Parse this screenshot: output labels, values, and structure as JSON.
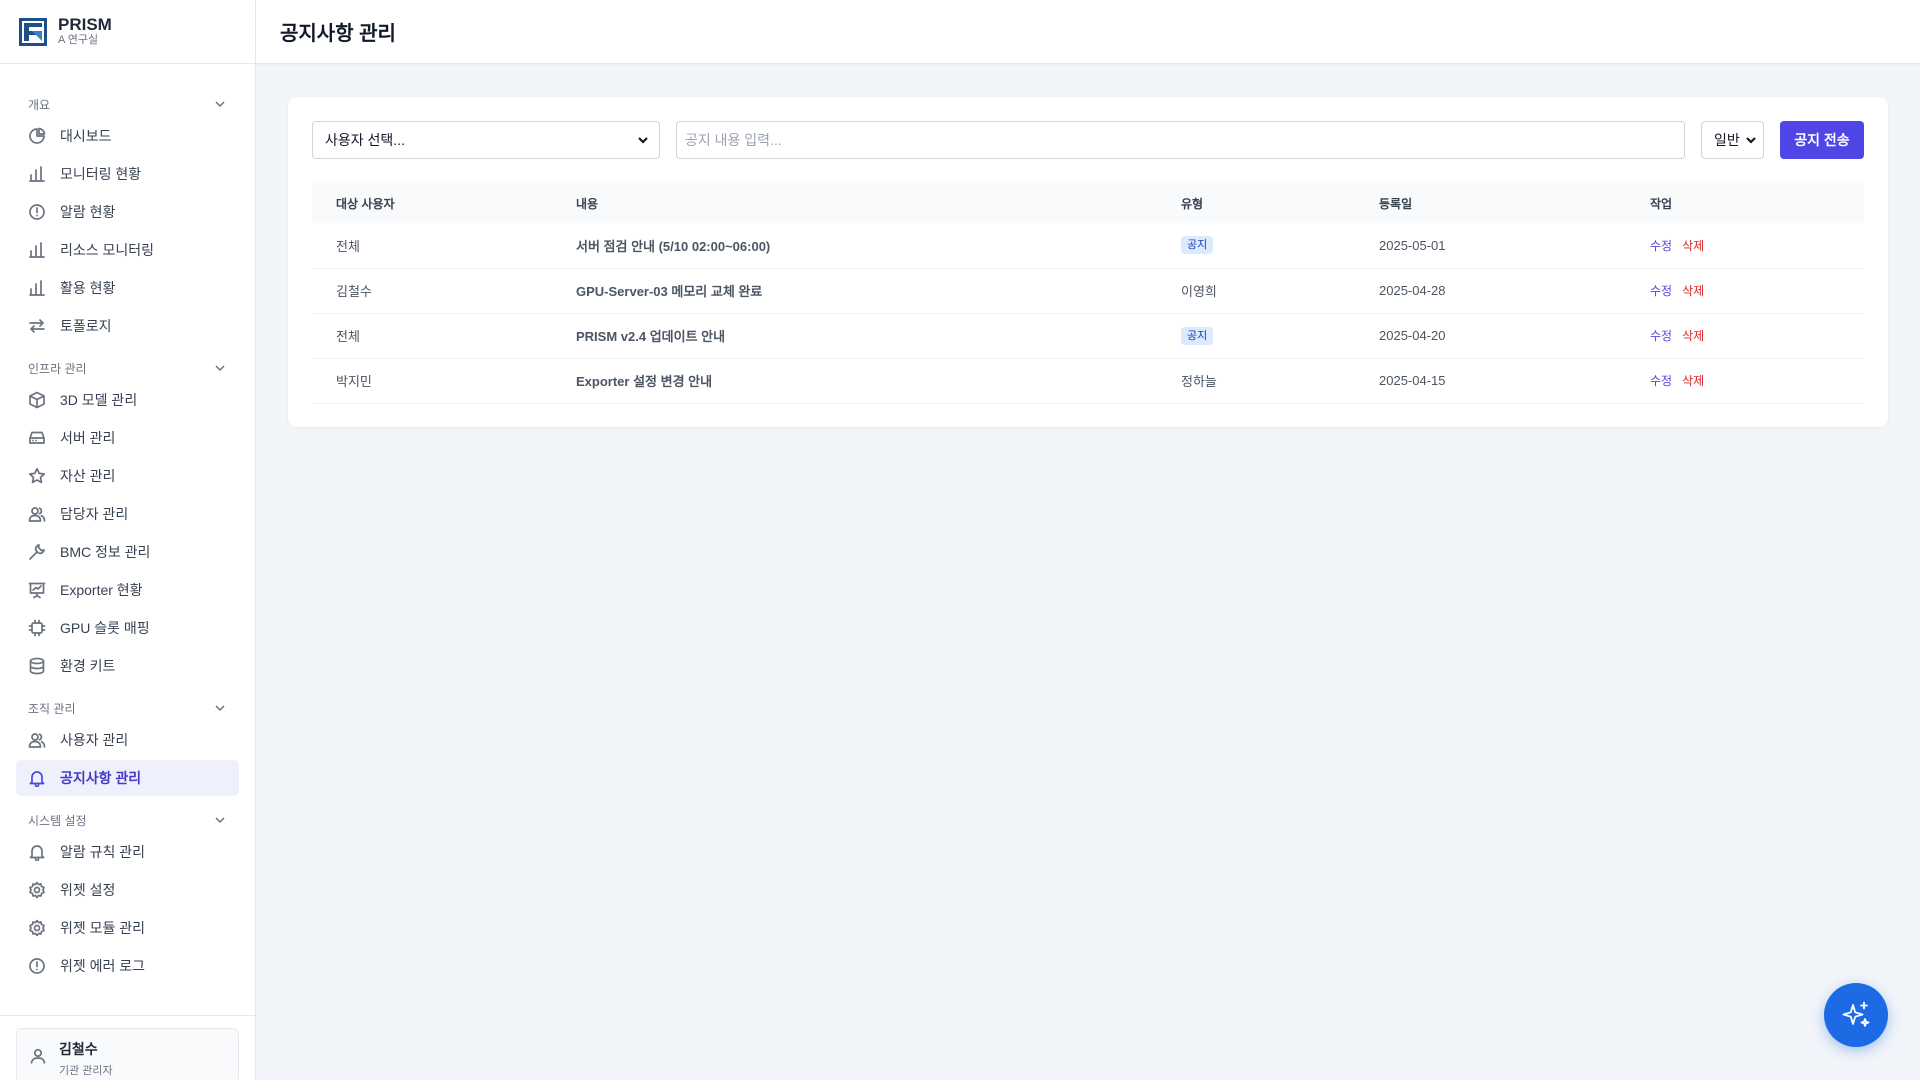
{
  "brand": {
    "name": "PRISM",
    "subtitle": "A 연구실"
  },
  "header": {
    "title": "공지사항 관리"
  },
  "sidebar": {
    "sections": [
      {
        "label": "개요",
        "items": [
          {
            "label": "대시보드",
            "icon": "pie-chart-icon"
          },
          {
            "label": "모니터링 현황",
            "icon": "bar-chart-icon"
          },
          {
            "label": "알람 현황",
            "icon": "alert-circle-icon"
          },
          {
            "label": "리소스 모니터링",
            "icon": "bar-chart-icon"
          },
          {
            "label": "활용 현황",
            "icon": "bar-chart-icon"
          },
          {
            "label": "토폴로지",
            "icon": "arrows-exchange-icon"
          }
        ]
      },
      {
        "label": "인프라 관리",
        "items": [
          {
            "label": "3D 모델 관리",
            "icon": "cube-icon"
          },
          {
            "label": "서버 관리",
            "icon": "server-drive-icon"
          },
          {
            "label": "자산 관리",
            "icon": "star-icon"
          },
          {
            "label": "담당자 관리",
            "icon": "users-icon"
          },
          {
            "label": "BMC 정보 관리",
            "icon": "wrench-icon"
          },
          {
            "label": "Exporter 현황",
            "icon": "presentation-icon"
          },
          {
            "label": "GPU 슬롯 매핑",
            "icon": "chip-icon"
          },
          {
            "label": "환경 키트",
            "icon": "database-icon"
          }
        ]
      },
      {
        "label": "조직 관리",
        "items": [
          {
            "label": "사용자 관리",
            "icon": "users-icon"
          },
          {
            "label": "공지사항 관리",
            "icon": "bell-icon",
            "active": true
          }
        ]
      },
      {
        "label": "시스템 설정",
        "items": [
          {
            "label": "알람 규칙 관리",
            "icon": "bell-icon"
          },
          {
            "label": "위젯 설정",
            "icon": "gear-icon"
          },
          {
            "label": "위젯 모듈 관리",
            "icon": "gear-icon"
          },
          {
            "label": "위젯 에러 로그",
            "icon": "alert-circle-icon"
          }
        ]
      }
    ]
  },
  "user": {
    "name": "김철수",
    "role": "기관 관리자"
  },
  "form": {
    "user_select": "사용자 선택...",
    "content_placeholder": "공지 내용 입력...",
    "type_select": "일반",
    "send_label": "공지 전송"
  },
  "table": {
    "columns": [
      "대상 사용자",
      "내용",
      "유형",
      "등록일",
      "작업"
    ],
    "rows": [
      {
        "target": "전체",
        "content": "서버 점검 안내 (5/10 02:00~06:00)",
        "type": "공지",
        "type_badge": true,
        "date": "2025-05-01",
        "edit": "수정",
        "delete": "삭제"
      },
      {
        "target": "김철수",
        "content": "GPU-Server-03 메모리 교체 완료",
        "type": "이영희",
        "type_badge": false,
        "date": "2025-04-28",
        "edit": "수정",
        "delete": "삭제"
      },
      {
        "target": "전체",
        "content": "PRISM v2.4 업데이트 안내",
        "type": "공지",
        "type_badge": true,
        "date": "2025-04-20",
        "edit": "수정",
        "delete": "삭제"
      },
      {
        "target": "박지민",
        "content": "Exporter 설정 변경 안내",
        "type": "정하늘",
        "type_badge": false,
        "date": "2025-04-15",
        "edit": "수정",
        "delete": "삭제"
      }
    ]
  },
  "fab": {
    "icon": "sparkles-icon"
  },
  "colors": {
    "accent": "#4f46e5",
    "danger": "#dc2626",
    "fab": "#1d6ae5",
    "badge_bg": "#dbeafe"
  }
}
